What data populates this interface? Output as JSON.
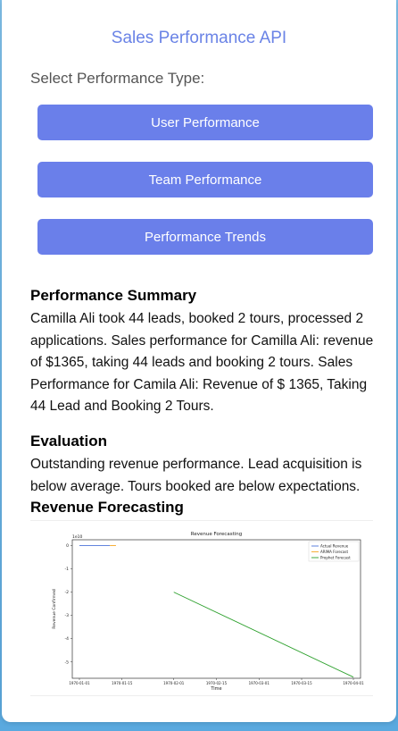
{
  "page": {
    "title": "Sales Performance API",
    "select_label": "Select Performance Type:"
  },
  "buttons": {
    "user": "User Performance",
    "team": "Team Performance",
    "trends": "Performance Trends"
  },
  "summary": {
    "heading": "Performance Summary",
    "text": "Camilla Ali took 44 leads, booked 2 tours, processed 2 applications. Sales performance for Camilla Ali: revenue of $1365, taking 44 leads and booking 2 tours. Sales Performance for Camila Ali: Revenue of $ 1365, Taking 44 Lead and Booking 2 Tours."
  },
  "evaluation": {
    "heading": "Evaluation",
    "text": "Outstanding revenue performance. Lead acquisition is below average. Tours booked are below expectations."
  },
  "forecast": {
    "heading": "Revenue Forecasting"
  },
  "chart_data": {
    "type": "line",
    "title": "Revenue Forecasting",
    "xlabel": "Time",
    "ylabel": "Revenue Confirmed",
    "y_multiplier_label": "1e10",
    "xlim": [
      "1970-01-01",
      "1970-04-01"
    ],
    "ylim": [
      -5.7,
      0.25
    ],
    "x_ticks": [
      "1970-01-01",
      "1970-01-15",
      "1970-02-01",
      "1970-02-15",
      "1970-03-01",
      "1970-03-15",
      "1970-04-01"
    ],
    "y_ticks": [
      0,
      -1,
      -2,
      -3,
      -4,
      -5
    ],
    "legend_position": "top-right",
    "series": [
      {
        "name": "Actual Revenue",
        "color": "#4c72d8",
        "x": [
          "1970-01-01",
          "1970-01-11"
        ],
        "y": [
          0,
          0
        ]
      },
      {
        "name": "ARIMA Forecast",
        "color": "#f5a623",
        "x": [
          "1970-01-11",
          "1970-01-13"
        ],
        "y": [
          0,
          0
        ]
      },
      {
        "name": "Prophet Forecast",
        "color": "#2ca02c",
        "x": [
          "1970-02-01",
          "1970-04-01"
        ],
        "y": [
          -2.0,
          -5.65
        ]
      }
    ]
  }
}
